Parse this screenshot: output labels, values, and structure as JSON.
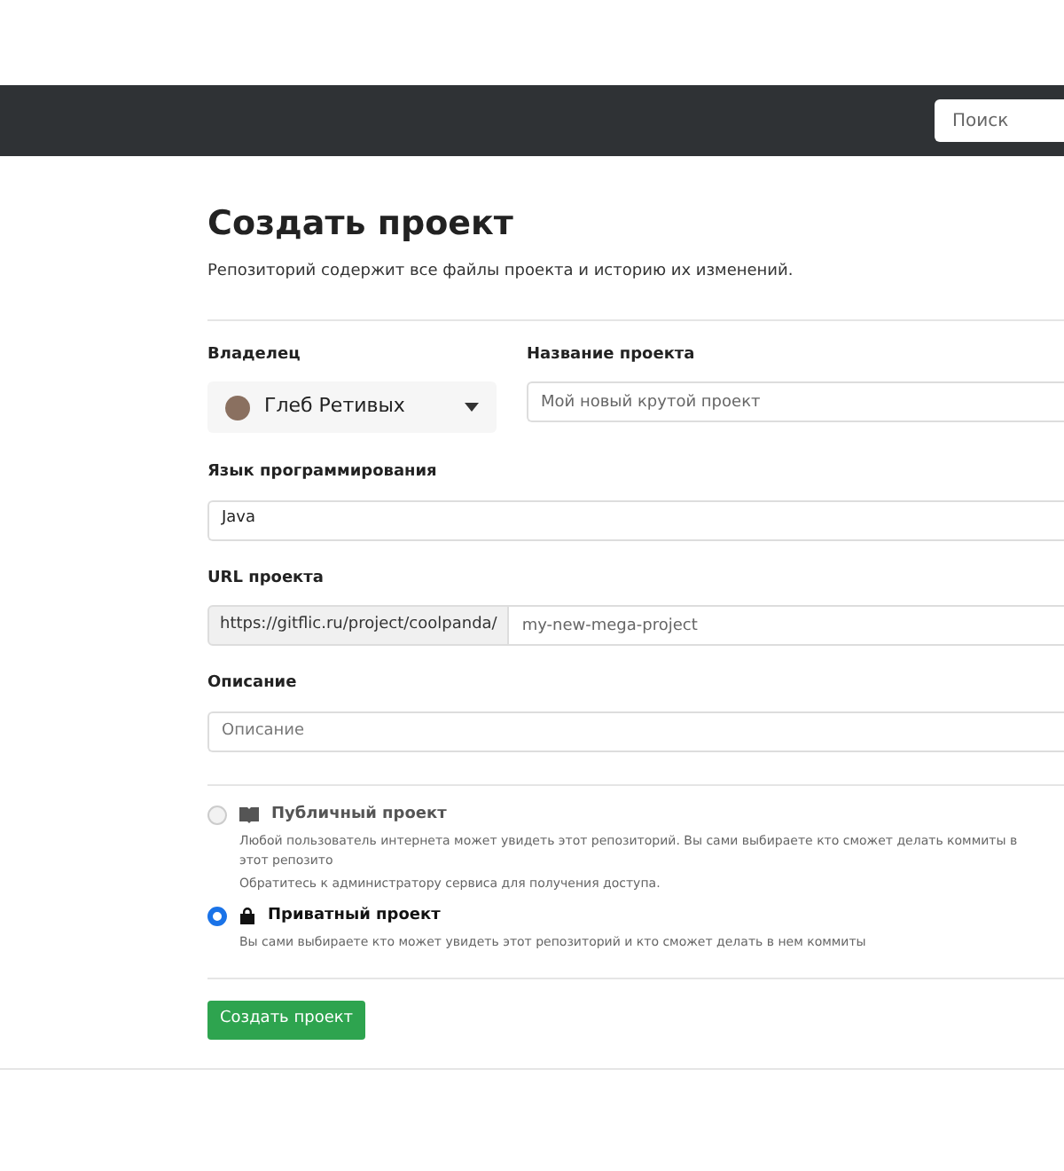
{
  "header": {
    "search": {
      "placeholder": "Поиск"
    }
  },
  "title": "Создать проект",
  "subtitle": "Репозиторий содержит все файлы проекта и историю их изменений.",
  "owner": {
    "label": "Владелец",
    "value": "Глеб Ретивых"
  },
  "project_name": {
    "label": "Название проекта",
    "placeholder": "Мой новый крутой проект"
  },
  "language": {
    "label": "Язык программирования",
    "value": "Java"
  },
  "url": {
    "label": "URL проекта",
    "prefix": "https://gitflic.ru/project/coolpanda/",
    "placeholder": "my-new-mega-project"
  },
  "description": {
    "label": "Описание",
    "placeholder": "Описание"
  },
  "visibility": [
    {
      "kind": "public",
      "label": "Публичный проект",
      "selected": false,
      "lines": [
        "Любой пользователь интернета может увидеть этот репозиторий. Вы сами выбираете кто сможет делать коммиты в этот репозито",
        "Обратитесь к администратору сервиса для получения доступа."
      ]
    },
    {
      "kind": "private",
      "label": "Приватный проект",
      "selected": true,
      "lines": [
        "Вы сами выбираете кто может увидеть этот репозиторий и кто сможет делать в нем коммиты"
      ]
    }
  ],
  "submit": "Создать проект"
}
